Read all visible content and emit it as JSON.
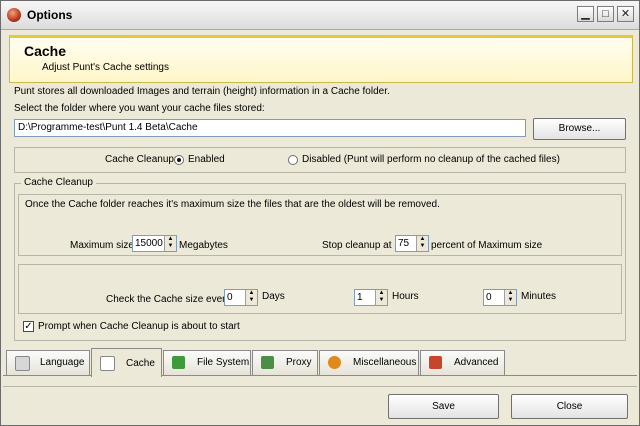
{
  "window": {
    "title": "Options"
  },
  "header": {
    "title": "Cache",
    "subtitle": "Adjust Punt's Cache settings"
  },
  "info": {
    "description": "Punt stores all downloaded Images and terrain (height) information in a Cache folder.",
    "select_prompt": "Select the folder where you want your cache files stored:"
  },
  "folder": {
    "path": "D:\\Programme-test\\Punt 1.4 Beta\\Cache",
    "browse_label": "Browse..."
  },
  "cleanup_mode": {
    "label": "Cache Cleanup:",
    "options": [
      {
        "label": "Enabled",
        "selected": true
      },
      {
        "label": "Disabled (Punt will perform no cleanup of the cached files)",
        "selected": false
      }
    ]
  },
  "cleanup_group": {
    "title": "Cache Cleanup",
    "description": "Once the Cache folder reaches it's maximum size the files that are the oldest will be removed.",
    "max_size": {
      "label": "Maximum size:",
      "value": "15000",
      "unit": "Megabytes"
    },
    "stop_cleanup": {
      "label": "Stop cleanup at",
      "value": "75",
      "unit": "percent of Maximum size"
    },
    "check_interval": {
      "label": "Check the Cache size every:",
      "days": {
        "value": "0",
        "unit": "Days"
      },
      "hours": {
        "value": "1",
        "unit": "Hours"
      },
      "minutes": {
        "value": "0",
        "unit": "Minutes"
      }
    },
    "prompt": {
      "label": "Prompt when Cache Cleanup is about to start",
      "checked": true
    }
  },
  "tabs": [
    {
      "label": "Language",
      "icon": "language-icon",
      "color": "#d7d7d7"
    },
    {
      "label": "Cache",
      "icon": "cache-icon",
      "color": "#ffffff",
      "active": true
    },
    {
      "label": "File System",
      "icon": "file-system-icon",
      "color": "#3f9b3a"
    },
    {
      "label": "Proxy",
      "icon": "proxy-icon",
      "color": "#4a8f45"
    },
    {
      "label": "Miscellaneous",
      "icon": "miscellaneous-icon",
      "color": "#e08a1c"
    },
    {
      "label": "Advanced",
      "icon": "advanced-icon",
      "color": "#c8442a"
    }
  ],
  "buttons": {
    "save_label": "Save",
    "close_label": "Close"
  }
}
